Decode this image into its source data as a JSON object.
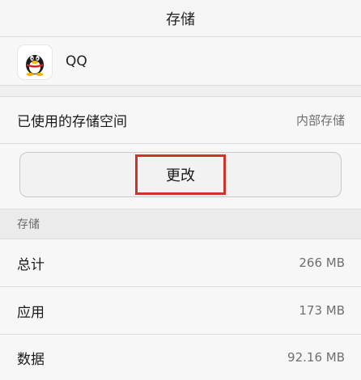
{
  "header": {
    "title": "存储"
  },
  "app": {
    "icon": "qq-penguin-icon",
    "name": "QQ"
  },
  "storage_used": {
    "label": "已使用的存储空间",
    "value": "内部存储"
  },
  "change_button": {
    "label": "更改"
  },
  "section": {
    "title": "存储"
  },
  "rows": [
    {
      "label": "总计",
      "value": "266 MB"
    },
    {
      "label": "应用",
      "value": "173 MB"
    },
    {
      "label": "数据",
      "value": "92.16 MB"
    }
  ],
  "colors": {
    "highlight_box": "#d0332a",
    "background": "#f5f5f5",
    "section_header_bg": "#ebebeb"
  }
}
